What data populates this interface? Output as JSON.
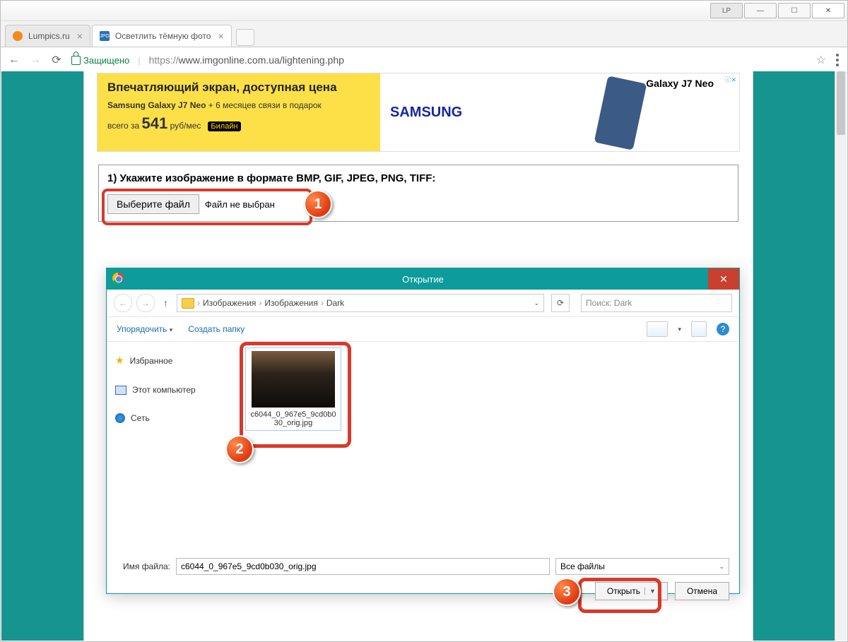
{
  "window_controls": {
    "lp": "LP"
  },
  "tabs": [
    {
      "title": "Lumpics.ru",
      "favicon": "#f28b1c"
    },
    {
      "title": "Осветлить тёмную фото",
      "favicon": "#2a6fb5",
      "favtext": "JPG"
    }
  ],
  "addressbar": {
    "secure_label": "Защищено",
    "protocol": "https://",
    "url_rest": "www.imgonline.com.ua/lightening.php"
  },
  "banner": {
    "headline": "Впечатляющий экран, доступная цена",
    "sub_prefix": "Samsung Galaxy J7 Neo",
    "sub_suffix": " + 6 месяцев связи в подарок",
    "price_prefix": "всего за ",
    "price": "541",
    "price_suffix": " руб/мес",
    "carrier": "Билайн",
    "brand": "SAMSUNG",
    "product": "Galaxy J7 Neo",
    "ad_badge": "ⓘ✕"
  },
  "form": {
    "step_label": "1) Укажите изображение в формате BMP, GIF, JPEG, PNG, TIFF:",
    "choose_btn": "Выберите файл",
    "no_file": "Файл не выбран"
  },
  "markers": {
    "m1": "1",
    "m2": "2",
    "m3": "3"
  },
  "dialog": {
    "title": "Открытие",
    "breadcrumb": [
      "Изображения",
      "Изображения",
      "Dark"
    ],
    "search_placeholder": "Поиск: Dark",
    "toolbar": {
      "organize": "Упорядочить",
      "new_folder": "Создать папку"
    },
    "sidebar": {
      "favorites": "Избранное",
      "computer": "Этот компьютер",
      "network": "Сеть"
    },
    "file": {
      "name": "c6044_0_967e5_9cd0b030_orig.jpg"
    },
    "footer": {
      "fname_label": "Имя файла:",
      "fname_value": "c6044_0_967e5_9cd0b030_orig.jpg",
      "filter": "Все файлы",
      "open": "Открыть",
      "cancel": "Отмена"
    }
  }
}
